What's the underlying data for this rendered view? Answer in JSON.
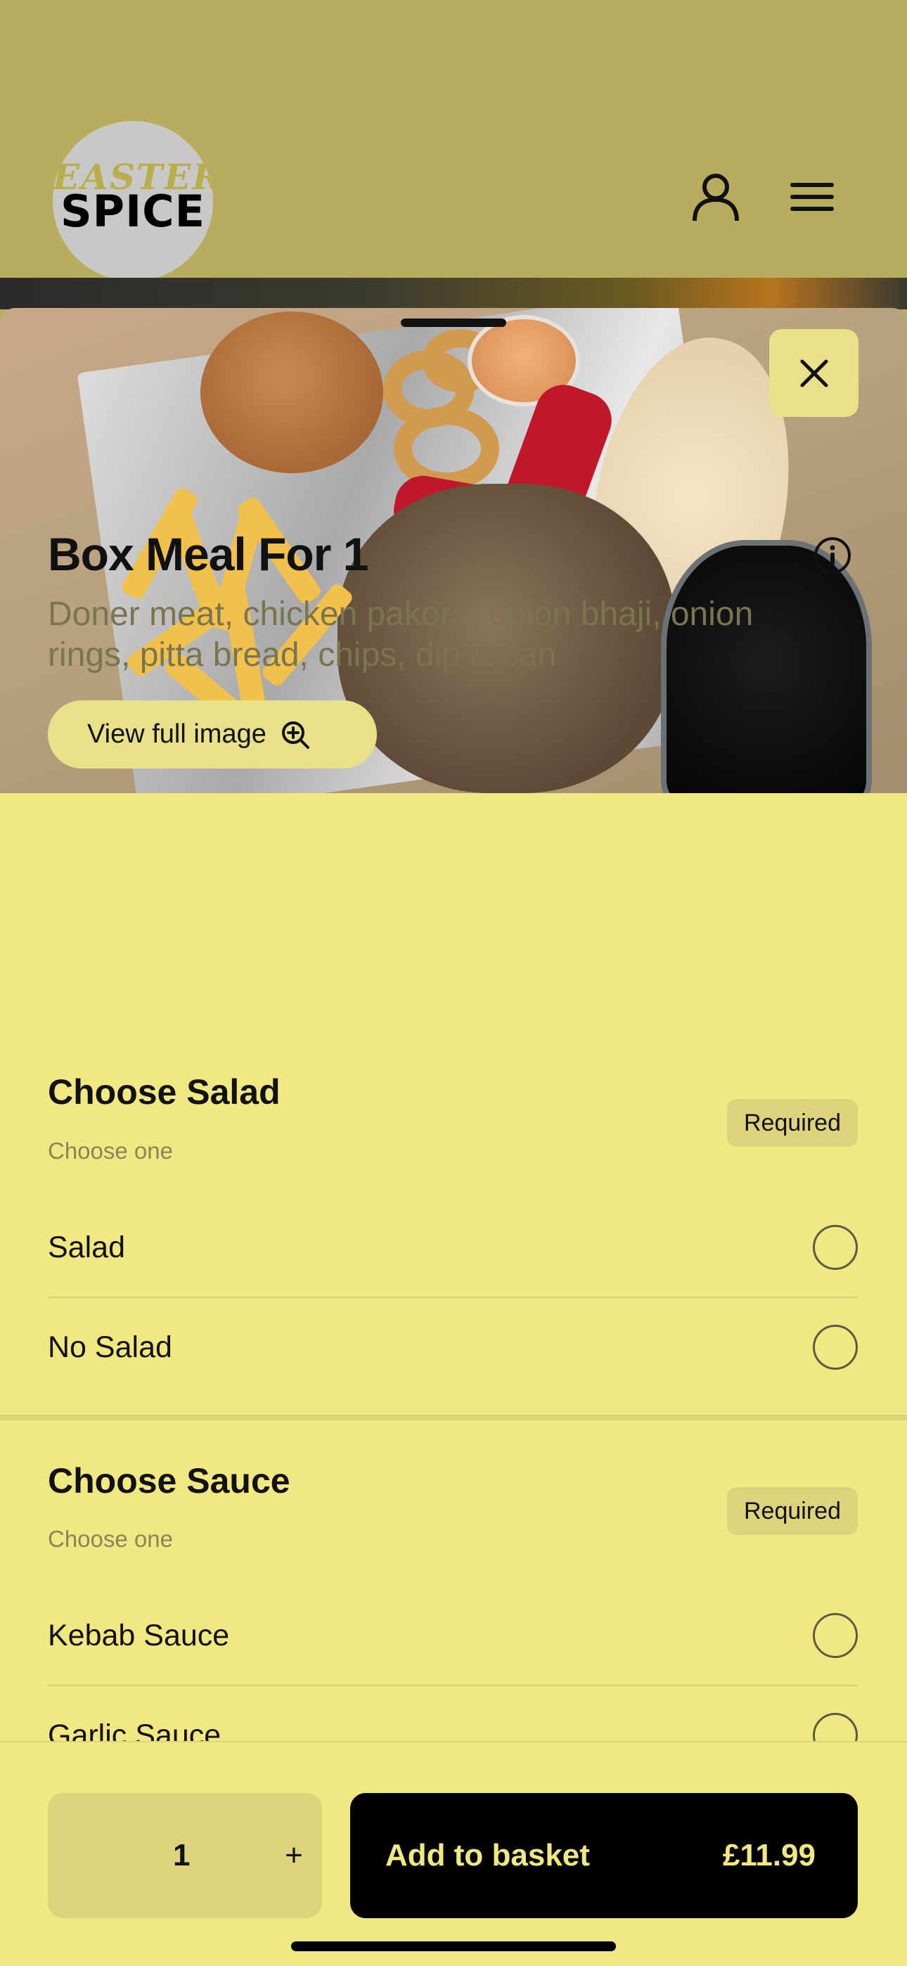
{
  "header": {
    "logo_line1": "EASTERN",
    "logo_line2": "SPICE",
    "account_icon": "person-icon",
    "menu_icon": "hamburger-menu-icon"
  },
  "item": {
    "view_image_label": "View full image",
    "title": "Box Meal For 1",
    "description": "Doner meat, chicken pakora, onion bhaji, onion rings, pitta bread, chips, dip & can"
  },
  "sections": [
    {
      "title": "Choose Salad",
      "subtitle": "Choose one",
      "badge": "Required",
      "options": [
        "Salad",
        "No Salad"
      ]
    },
    {
      "title": "Choose Sauce",
      "subtitle": "Choose one",
      "badge": "Required",
      "options": [
        "Kebab Sauce",
        "Garlic Sauce"
      ]
    }
  ],
  "footer": {
    "quantity": "1",
    "plus": "+",
    "add_label": "Add to basket",
    "price": "£11.99"
  },
  "colors": {
    "header_bg": "#b7ad5e",
    "sheet_bg": "#f2e882",
    "accent_button": "#000000"
  }
}
